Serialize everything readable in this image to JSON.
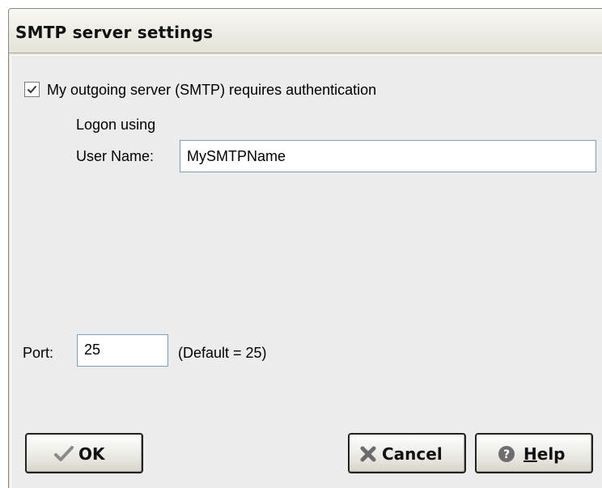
{
  "window": {
    "title": "SMTP server settings"
  },
  "auth": {
    "checkbox_label": "My outgoing server (SMTP) requires authentication",
    "checked": true,
    "logon_label": "Logon using",
    "username_label": "User Name:",
    "username_value": "MySMTPName"
  },
  "port": {
    "label": "Port:",
    "value": "25",
    "default_hint": "(Default = 25)"
  },
  "buttons": {
    "ok": {
      "label": "OK",
      "icon": "checkmark-icon"
    },
    "cancel": {
      "label": "Cancel",
      "icon": "cross-icon"
    },
    "help": {
      "label_first": "H",
      "label_rest": "elp",
      "icon": "question-icon"
    }
  }
}
